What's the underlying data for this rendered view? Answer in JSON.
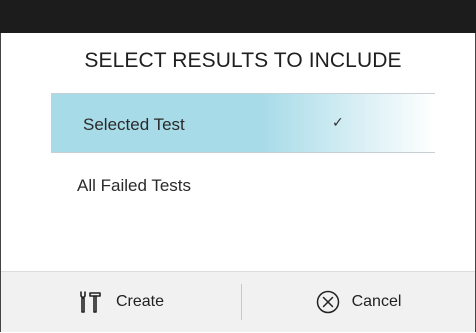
{
  "dialog": {
    "title": "SELECT RESULTS TO INCLUDE",
    "options": [
      {
        "label": "Selected Test",
        "selected": true,
        "indicator": "check-icon"
      },
      {
        "label": "All Failed Tests",
        "selected": false
      }
    ],
    "footer": {
      "create_label": "Create",
      "create_icon": "tools-icon",
      "cancel_label": "Cancel",
      "cancel_icon": "circle-x-icon"
    }
  },
  "colors": {
    "selected_highlight": "#a8dbe8",
    "top_bar": "#1c1c1c",
    "footer_bg": "#f1f1f1"
  }
}
